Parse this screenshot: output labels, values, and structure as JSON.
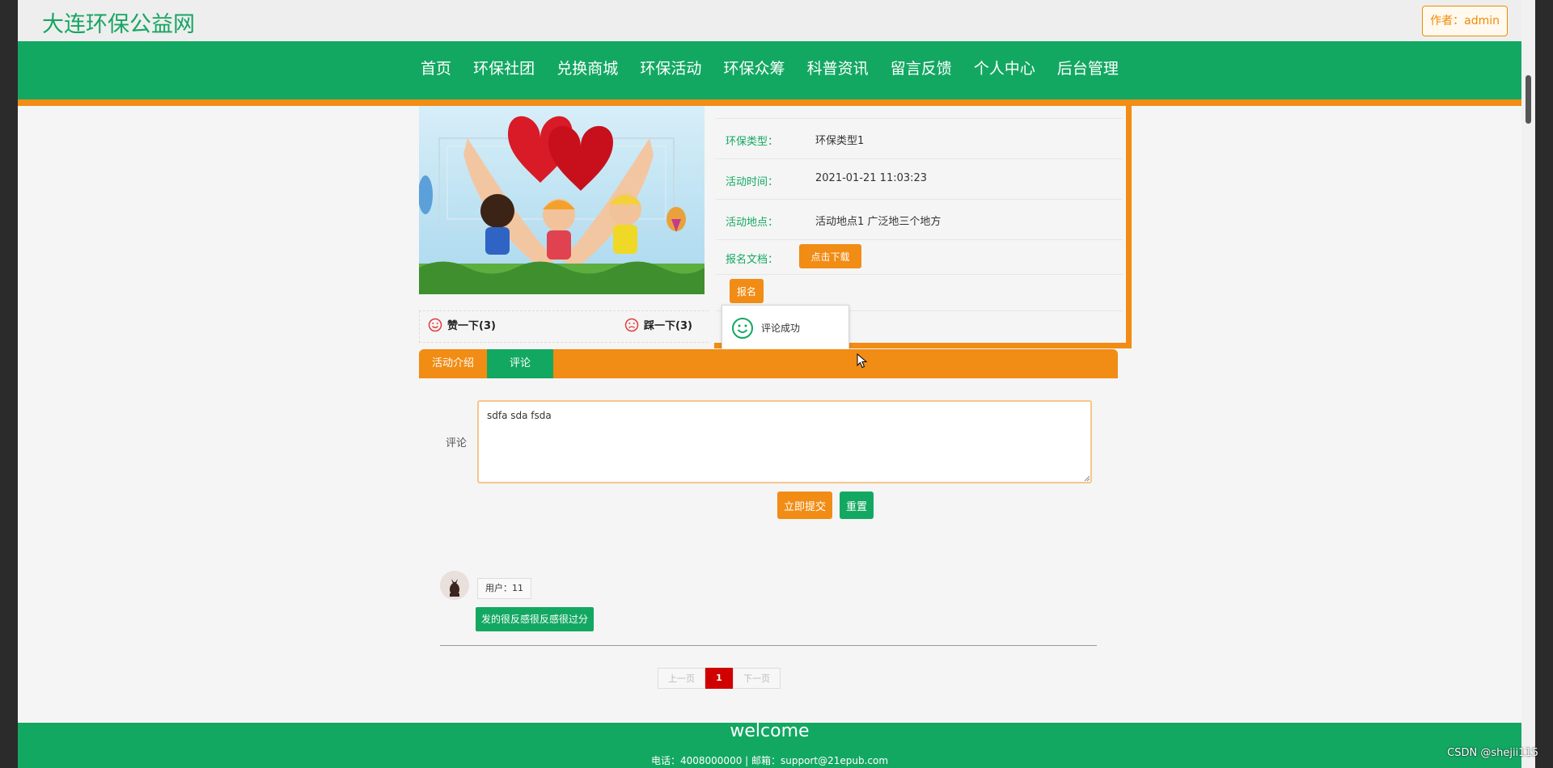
{
  "site": {
    "title": "大连环保公益网",
    "author": "作者：admin"
  },
  "nav": [
    "首页",
    "环保社团",
    "兑换商城",
    "环保活动",
    "环保众筹",
    "科普资讯",
    "留言反馈",
    "个人中心",
    "后台管理"
  ],
  "detail": {
    "type_label": "环保类型：",
    "type_value": "环保类型1",
    "time_label": "活动时间：",
    "time_value": "2021-01-21 11:03:23",
    "place_label": "活动地点：",
    "place_value": "活动地点1 广泛地三个地方",
    "doc_label": "报名文档：",
    "download_btn": "点击下载",
    "signup_btn": "报名"
  },
  "votes": {
    "like": "赞一下(3)",
    "dislike": "踩一下(3)"
  },
  "toast": {
    "text": "评论成功"
  },
  "tabs": [
    "活动介绍",
    "评论"
  ],
  "comment_form": {
    "label": "评论",
    "value": "sdfa sda fsda",
    "submit": "立即提交",
    "reset": "重置"
  },
  "comments": [
    {
      "user": "用户：11",
      "content": "发的很反感很反感很过分"
    }
  ],
  "pagination": {
    "prev": "上一页",
    "current": "1",
    "next": "下一页"
  },
  "footer": {
    "title": "welcome",
    "contact": "电话：4008000000 | 邮箱：support@21epub.com"
  },
  "watermark": "CSDN @shejii115",
  "colors": {
    "primary": "#13a862",
    "accent": "#f18c14",
    "page_active": "#d10000"
  }
}
